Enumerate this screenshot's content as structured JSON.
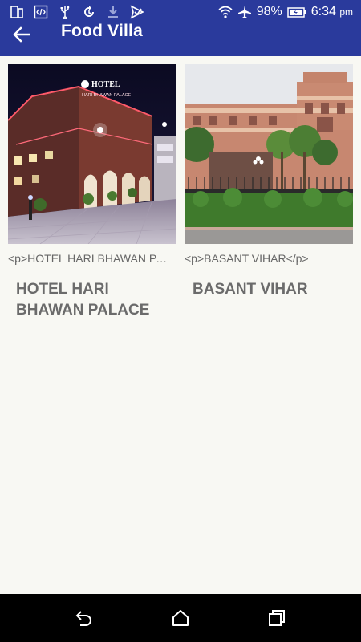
{
  "status_bar": {
    "battery_percent": "98%",
    "time": "6:34",
    "ampm": "pm",
    "icons_left": [
      "sim-card-icon",
      "code-icon",
      "usb-icon",
      "sync-icon",
      "download-icon",
      "send-icon"
    ],
    "icons_right": [
      "wifi-icon",
      "airplane-icon",
      "battery-icon"
    ]
  },
  "app_bar": {
    "title": "Food Villa",
    "back_icon": "arrow-left-icon",
    "color": "#2a3a9c"
  },
  "cards": [
    {
      "subtitle": "<p>HOTEL HARI BHAWAN PALACE</p>",
      "title": "HOTEL HARI BHAWAN PALACE",
      "image": "hotel-night-photo",
      "sign_text": "HOTEL",
      "sign_subtext": "HARI BHAWAN PALACE"
    },
    {
      "subtitle": "<p>BASANT VIHAR</p>",
      "title": "BASANT VIHAR",
      "image": "palace-garden-photo"
    }
  ],
  "nav_bar": {
    "icons": [
      "nav-back-icon",
      "nav-home-icon",
      "nav-recents-icon"
    ]
  }
}
